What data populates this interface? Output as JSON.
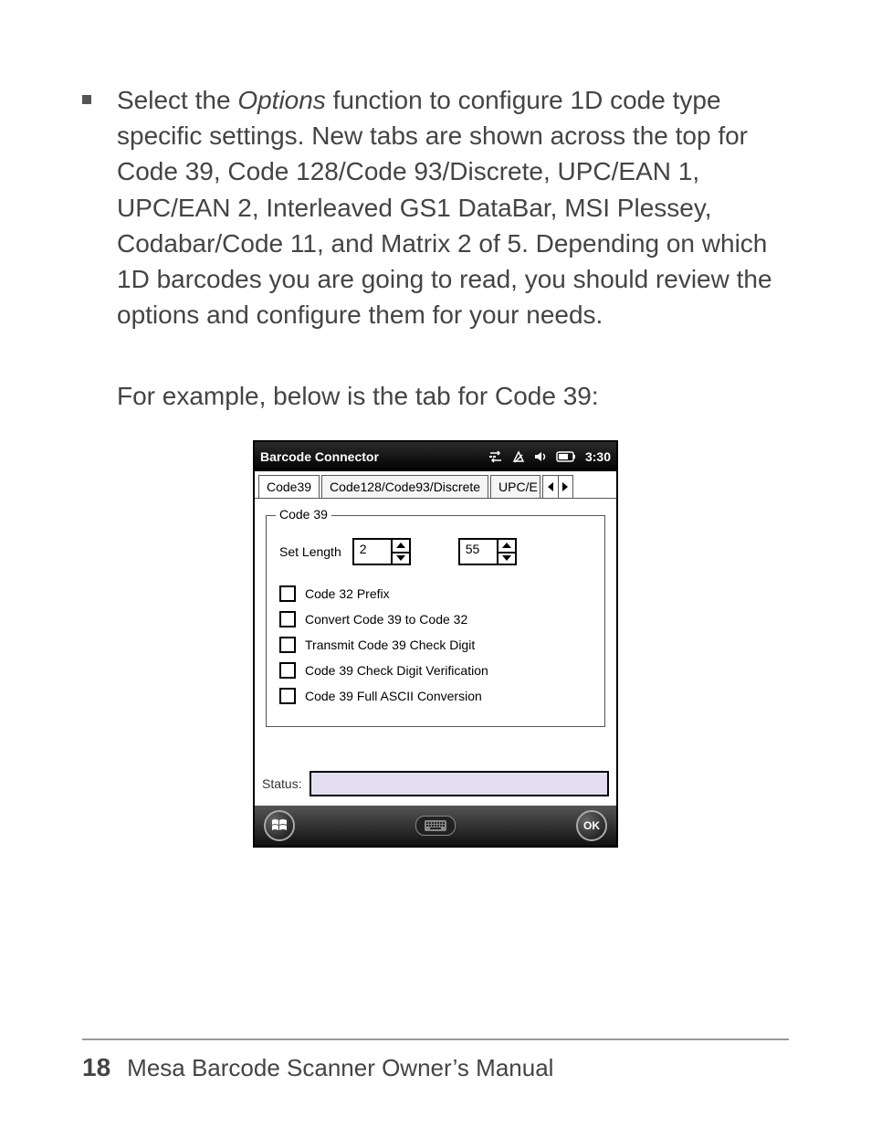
{
  "body": {
    "bullet_pre": "Select the ",
    "bullet_italic": "Options",
    "bullet_post": " function to configure 1D code type specific settings. New tabs are shown across the top for Code 39, Code 128/Code 93/Discrete, UPC/EAN 1, UPC/EAN 2, Interleaved GS1 DataBar, MSI Plessey, Codabar/Code 11, and Matrix 2 of 5. Depending on which 1D barcodes you are going to read, you should review the options and configure them for your needs.",
    "para2": "For example, below is the tab for Code 39:"
  },
  "device": {
    "titlebar": {
      "title": "Barcode Connector",
      "time": "3:30"
    },
    "tabs": {
      "t0": "Code39",
      "t1": "Code128/Code93/Discrete",
      "t2": "UPC/E"
    },
    "group": {
      "legend": "Code 39",
      "set_length_label": "Set Length",
      "len1": "2",
      "len2": "55",
      "chk0": "Code 32 Prefix",
      "chk1": "Convert Code 39 to Code 32",
      "chk2": "Transmit Code 39 Check Digit",
      "chk3": "Code 39 Check Digit Verification",
      "chk4": "Code 39 Full ASCII Conversion"
    },
    "status_label": "Status:",
    "ok_label": "OK"
  },
  "footer": {
    "page": "18",
    "title": "Mesa Barcode Scanner Owner’s Manual"
  }
}
